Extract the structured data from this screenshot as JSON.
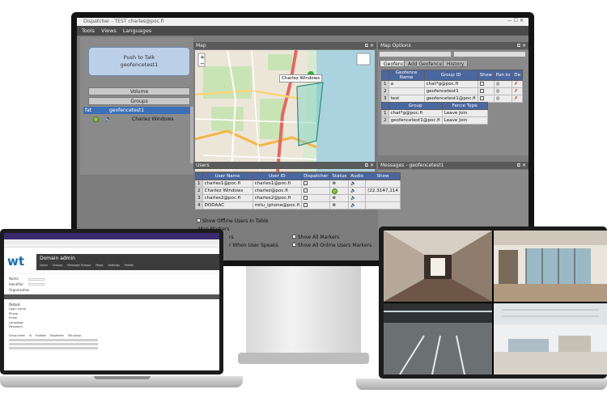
{
  "desktop_app": {
    "title": "Dispatcher - TEST charles@poc.fi",
    "menu": [
      "Tools",
      "Views",
      "Languages"
    ],
    "map_panel_title": "Map",
    "map_options_title": "Map Options",
    "ptt": {
      "line1": "Push to Talk",
      "line2": "geofencetest1"
    },
    "volume_label": "Volume",
    "groups_label": "Groups",
    "selected_group": {
      "prefix": "fat",
      "name": "geofencetest1"
    },
    "group_member": "Charlez Windows",
    "map_popup": "Charlez Windows",
    "map_options_tabs": [
      "Geofence",
      "Add Geofence",
      "History"
    ],
    "geofence_table": {
      "headers": [
        "Geofence Name",
        "Group ID",
        "Show",
        "Pan to",
        "De"
      ],
      "rows": [
        {
          "idx": "1",
          "name": "a",
          "group": "chat*g@poc.fi"
        },
        {
          "idx": "2",
          "name": "",
          "group": "geofencetest1"
        },
        {
          "idx": "3",
          "name": "test",
          "group": "geofencetest1@poc.fi"
        }
      ]
    },
    "fence_table": {
      "headers": [
        "Group",
        "Fence Type"
      ],
      "rows": [
        {
          "idx": "1",
          "group": "chat*g@poc.fi",
          "type": "Leave Join"
        },
        {
          "idx": "2",
          "group": "geofencetest1@poc.fi",
          "type": "Leave Join"
        }
      ]
    },
    "users_title": "Users",
    "messages_title": "Messages - geofencetest1",
    "users_table": {
      "headers": [
        "User Name",
        "User ID",
        "Dispatcher",
        "Status",
        "Audio",
        "Show"
      ],
      "rows": [
        {
          "idx": "1",
          "name": "charles1@poc.fi",
          "id": "charles1@poc.fi",
          "show": ""
        },
        {
          "idx": "2",
          "name": "Charlez Windows",
          "id": "charlez@poc.fi",
          "show": "(22.3147,114"
        },
        {
          "idx": "3",
          "name": "charles2@poc.fi",
          "id": "charles2@poc.fi",
          "show": ""
        },
        {
          "idx": "4",
          "name": "DODAAC",
          "id": "mitu_iphone@poc.fi",
          "show": ""
        }
      ]
    },
    "show_offline": "Show Offline Users In Table",
    "map_markers_label": "Map Markers",
    "marker_options": [
      "Show All Markers",
      "Show All Online Users Markers"
    ],
    "left_options_fragments": [
      "rs",
      "r When User Speaks"
    ]
  },
  "web_app": {
    "logo": "wt",
    "org": "Domain admin",
    "nav": [
      "Users",
      "Groups",
      "Message Groups",
      "Maps",
      "Settings",
      "Profile"
    ],
    "section_label": "Details",
    "field_labels": [
      "Name",
      "Identifier",
      "Organization",
      "Login name",
      "Phone",
      "Email",
      "Language",
      "Password"
    ],
    "table_headers": [
      "Group name",
      "Id",
      "Enabled",
      "Dispatcher",
      "Talk group"
    ]
  },
  "colors": {
    "panel_header": "#4a67a0",
    "selected": "#3d6fb6",
    "ptt_button": "#bcd0e8",
    "status_green": "#8dc63f",
    "wt_blue": "#1b6fae"
  }
}
